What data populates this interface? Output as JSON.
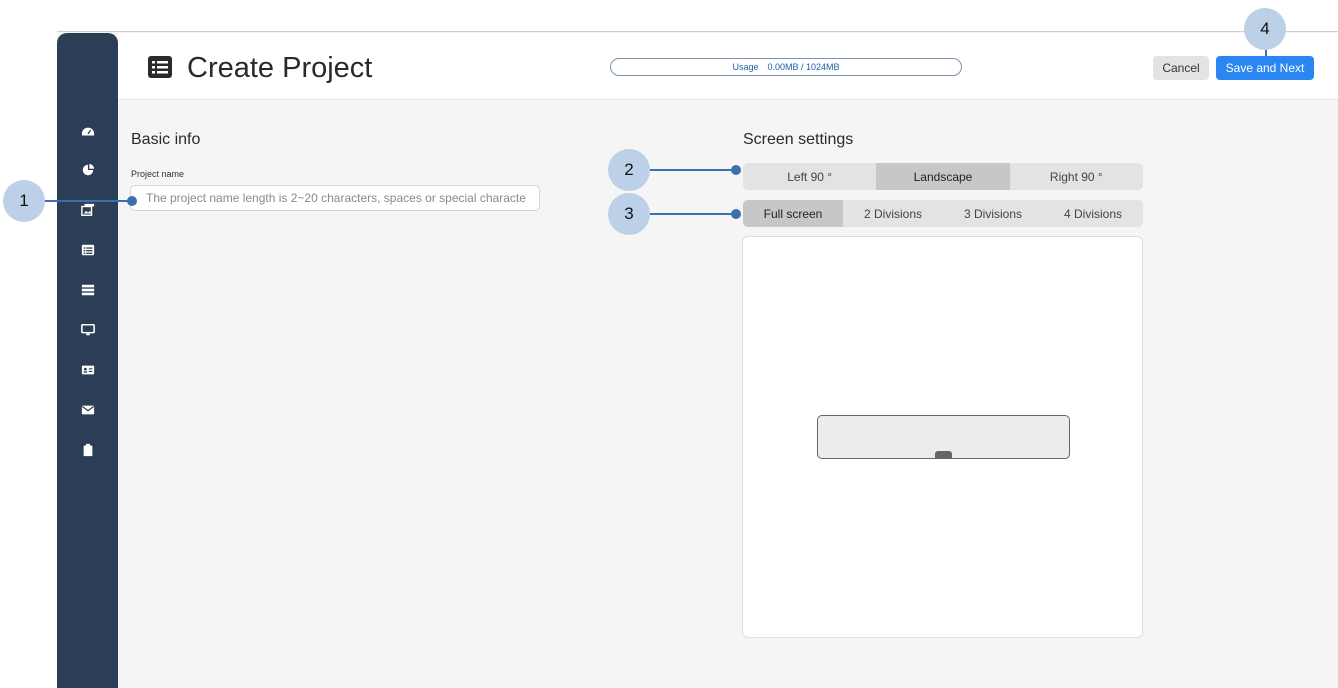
{
  "header": {
    "title": "Create Project",
    "usage_label": "Usage",
    "usage_value": "0.00MB / 1024MB",
    "cancel_label": "Cancel",
    "save_label": "Save and Next"
  },
  "sidebar": {
    "items": [
      {
        "icon": "dashboard-icon"
      },
      {
        "icon": "pie-chart-icon"
      },
      {
        "icon": "media-icon"
      },
      {
        "icon": "list-icon"
      },
      {
        "icon": "server-icon"
      },
      {
        "icon": "monitor-icon"
      },
      {
        "icon": "id-card-icon"
      },
      {
        "icon": "envelope-icon"
      },
      {
        "icon": "clipboard-icon"
      }
    ]
  },
  "basic_info": {
    "title": "Basic info",
    "project_name_label": "Project name",
    "project_name_placeholder": "The project name length is 2~20 characters, spaces or special characte",
    "project_name_value": ""
  },
  "screen_settings": {
    "title": "Screen settings",
    "orientation_options": [
      "Left 90 °",
      "Landscape",
      "Right 90 °"
    ],
    "orientation_selected": "Landscape",
    "division_options": [
      "Full screen",
      "2 Divisions",
      "3 Divisions",
      "4 Divisions"
    ],
    "division_selected": "Full screen"
  },
  "callouts": [
    "1",
    "2",
    "3",
    "4"
  ],
  "colors": {
    "sidebar": "#2c3e55",
    "primary": "#2a86f0",
    "callout": "#bcd0e8",
    "callout_line": "#3a6fb0"
  }
}
